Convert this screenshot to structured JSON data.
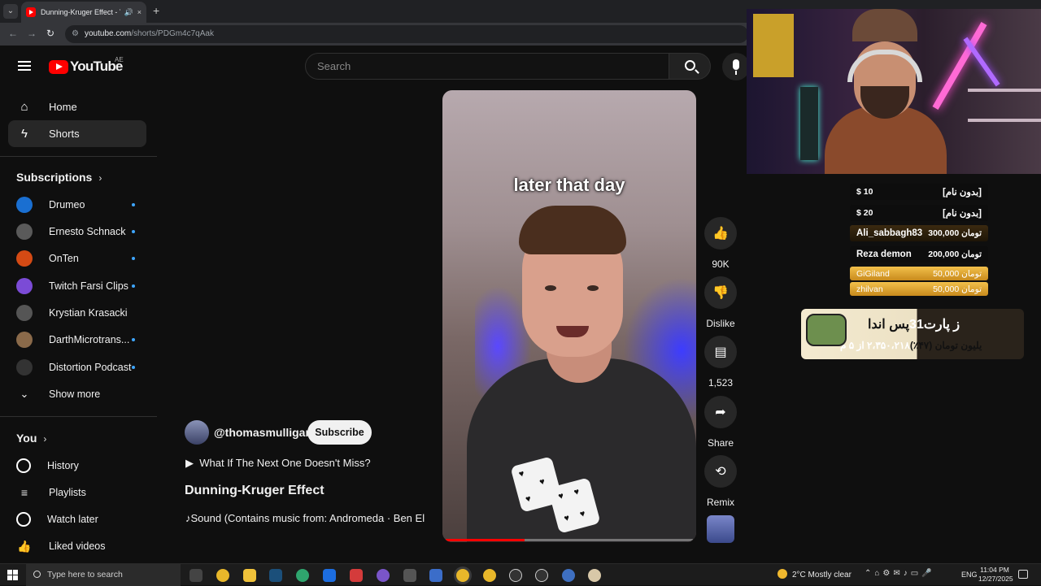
{
  "browser": {
    "tab_title": "Dunning-Kruger Effect - Yo",
    "tab_audio_icon": "speaker-icon",
    "url_host": "youtube.com",
    "url_path": "/shorts/PDGm4c7qAak",
    "new_tab": "+",
    "close": "×"
  },
  "header": {
    "logo_text": "YouTube",
    "country_code": "AE",
    "search_placeholder": "Search"
  },
  "sidebar": {
    "home": "Home",
    "shorts": "Shorts",
    "subscriptions_label": "Subscriptions",
    "subscriptions": [
      {
        "name": "Drumeo",
        "color": "#1a6fd1",
        "new": true
      },
      {
        "name": "Ernesto Schnack",
        "color": "#5a5a5a",
        "new": true
      },
      {
        "name": "OnTen",
        "color": "#d44a14",
        "new": true
      },
      {
        "name": "Twitch Farsi Clips",
        "color": "#7b4bd6",
        "new": true
      },
      {
        "name": "Krystian Krasacki",
        "color": "#555555",
        "new": false
      },
      {
        "name": "DarthMicrotrans...",
        "color": "#8a6a4a",
        "new": true
      },
      {
        "name": "Distortion Podcast",
        "color": "#333333",
        "new": true
      }
    ],
    "show_more": "Show more",
    "you_label": "You",
    "you_items": [
      "History",
      "Playlists",
      "Watch later",
      "Liked videos"
    ]
  },
  "short": {
    "caption": "later that day",
    "progress": 0.32,
    "channel": "@thomasmulligan",
    "subscribe": "Subscribe",
    "related": "What If The Next One Doesn't Miss?",
    "title": "Dunning-Kruger Effect",
    "sound": "Sound (Contains music from: Andromeda · Ben El",
    "actions": {
      "likes": "90K",
      "dislike": "Dislike",
      "comments": "1,523",
      "share": "Share",
      "remix": "Remix"
    }
  },
  "donations": [
    {
      "name": "[بدون نام]",
      "amount": "$ 10",
      "style": "dark"
    },
    {
      "name": "[بدون نام]",
      "amount": "$ 20",
      "style": "dark"
    },
    {
      "name": "Ali_sabbagh83",
      "amount": "300,000 تومان",
      "style": "gold"
    },
    {
      "name": "Reza demon",
      "amount": "200,000 تومان",
      "style": "dark"
    },
    {
      "name": "GiGiland",
      "amount": "50,000 تومان",
      "style": "gold2"
    },
    {
      "name": "zhilvan",
      "amount": "50,000 تومان",
      "style": "gold2"
    }
  ],
  "goal": {
    "title_a": "پس اندا",
    "title_b": "ز پارت31",
    "line_a": "۲،۳۵۰،۲۱۸ از ۵ م",
    "line_b": "یلیون تومان (۴۷٪)"
  },
  "taskbar": {
    "search_placeholder": "Type here to search",
    "weather": "2°C  Mostly clear",
    "lang": "ENG",
    "time": "11:04 PM",
    "date": "12/27/2025"
  }
}
